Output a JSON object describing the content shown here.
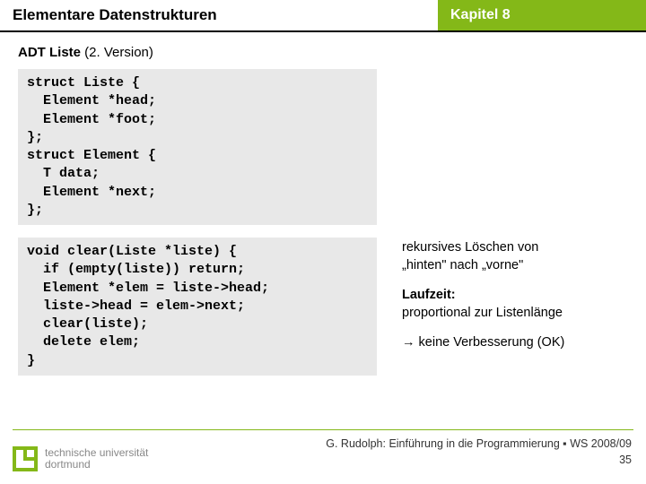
{
  "header": {
    "left": "Elementare Datenstrukturen",
    "right": "Kapitel 8"
  },
  "subtitle": {
    "bold": "ADT Liste",
    "rest": " (2. Version)"
  },
  "code1": "struct Liste {\n  Element *head;\n  Element *foot;\n};\nstruct Element {\n  T data;\n  Element *next;\n};",
  "code2": "void clear(Liste *liste) {\n  if (empty(liste)) return;\n  Element *elem = liste->head;\n  liste->head = elem->next;\n  clear(liste);\n  delete elem;\n}",
  "notes": {
    "n1a": "rekursives Löschen von",
    "n1b": "„hinten\" nach „vorne\"",
    "n2a": "Laufzeit:",
    "n2b": "proportional zur Listenlänge",
    "n3": "→ keine Verbesserung (OK)"
  },
  "logo": {
    "line1": "technische universität",
    "line2": "dortmund"
  },
  "footer": {
    "line1": "G. Rudolph: Einführung in die Programmierung ▪ WS 2008/09",
    "line2": "35"
  }
}
